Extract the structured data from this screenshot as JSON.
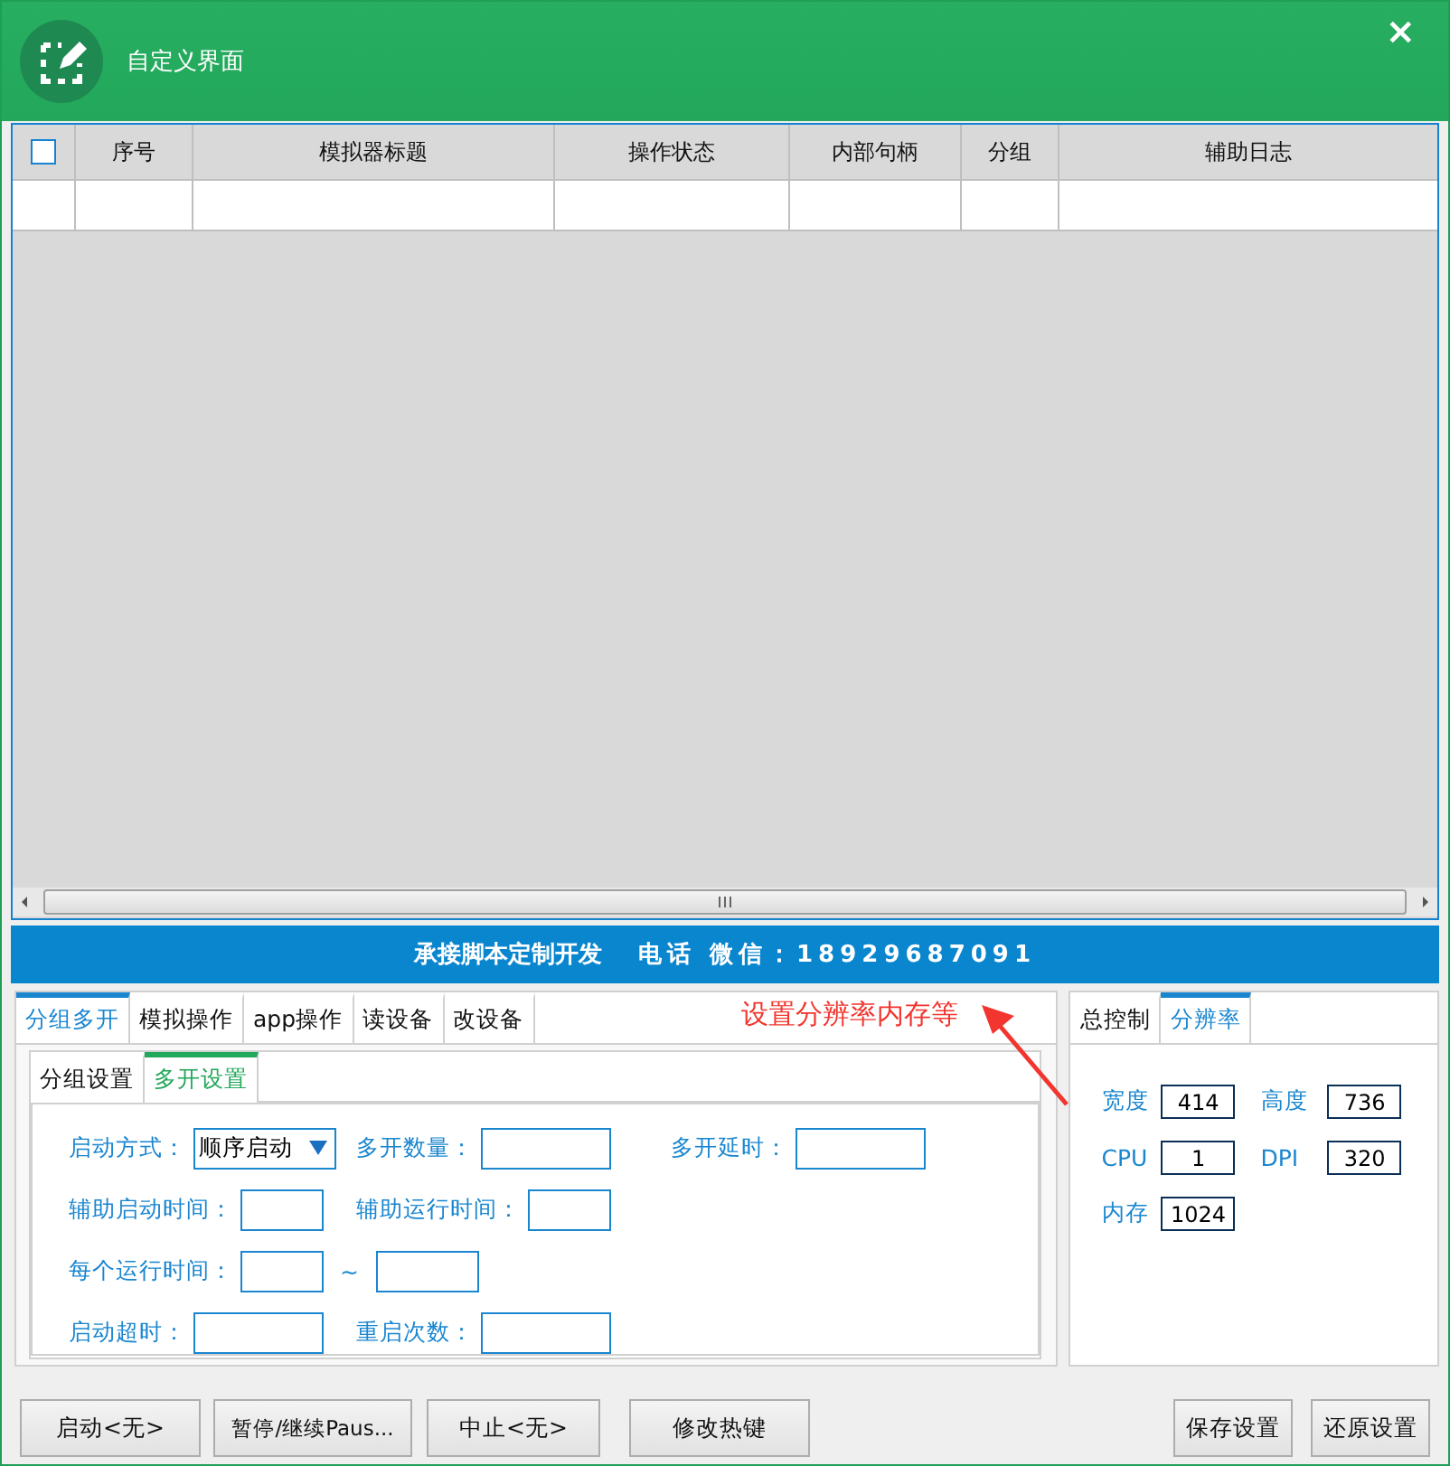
{
  "window": {
    "title": "自定义界面",
    "close": "×"
  },
  "table": {
    "header_checkbox": {
      "checked": false
    },
    "columns": [
      "序号",
      "模拟器标题",
      "操作状态",
      "内部句柄",
      "分组",
      "辅助日志"
    ]
  },
  "banner": {
    "slogan": "承接脚本定制开发",
    "contact": "电话 微信：18929687091"
  },
  "left_panel": {
    "tabs": [
      {
        "label": "分组多开",
        "selected": true
      },
      {
        "label": "模拟操作",
        "selected": false
      },
      {
        "label": "app操作",
        "selected": false
      },
      {
        "label": "读设备",
        "selected": false
      },
      {
        "label": "改设备",
        "selected": false
      }
    ],
    "subtabs": [
      {
        "label": "分组设置",
        "selected": false
      },
      {
        "label": "多开设置",
        "selected": true
      }
    ],
    "rows": [
      [
        {
          "kind": "labeled",
          "label": "启动方式：",
          "field": {
            "kind": "select",
            "value": "顺序启动"
          }
        },
        {
          "kind": "labeled",
          "label": "多开数量：",
          "field": {
            "kind": "input"
          }
        },
        {
          "kind": "labeled",
          "label": "多开延时：",
          "field": {
            "kind": "input"
          }
        }
      ],
      [
        {
          "kind": "labeled",
          "label": "辅助启动时间：",
          "field": {
            "kind": "input"
          }
        },
        {
          "kind": "labeled",
          "label": "辅助运行时间：",
          "field": {
            "kind": "input"
          }
        }
      ],
      [
        {
          "kind": "labeled",
          "label": "每个运行时间：",
          "field": {
            "kind": "input"
          }
        },
        {
          "kind": "range",
          "label": "~",
          "field": {
            "kind": "input"
          }
        }
      ],
      [
        {
          "kind": "labeled",
          "label": "启动超时：",
          "field": {
            "kind": "input"
          }
        },
        {
          "kind": "labeled",
          "label": "重启次数：",
          "field": {
            "kind": "input"
          }
        }
      ]
    ]
  },
  "annotation": {
    "text": "设置分辨率内存等"
  },
  "right_panel": {
    "tabs": [
      {
        "label": "总控制",
        "selected": false
      },
      {
        "label": "分辨率",
        "selected": true
      }
    ],
    "fields": [
      {
        "label": "宽度",
        "value": "414"
      },
      {
        "label": "高度",
        "value": "736"
      },
      {
        "label": "CPU",
        "value": "1"
      },
      {
        "label": "DPI",
        "value": "320"
      },
      {
        "label": "内存",
        "value": "1024"
      }
    ]
  },
  "buttons_left": [
    "启动<无>",
    "暂停/继续Paus...",
    "中止<无>",
    "修改热键"
  ],
  "buttons_right": [
    "保存设置",
    "还原设置"
  ]
}
